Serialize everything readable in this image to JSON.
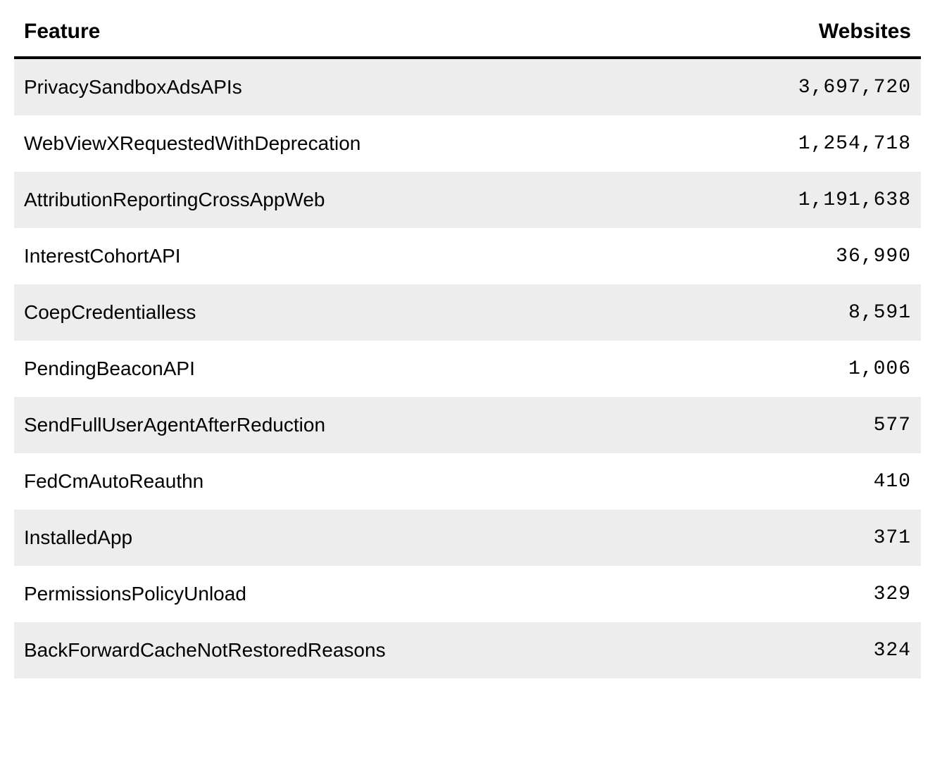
{
  "table": {
    "headers": {
      "feature": "Feature",
      "websites": "Websites"
    },
    "rows": [
      {
        "feature": "PrivacySandboxAdsAPIs",
        "websites": "3,697,720"
      },
      {
        "feature": "WebViewXRequestedWithDeprecation",
        "websites": "1,254,718"
      },
      {
        "feature": "AttributionReportingCrossAppWeb",
        "websites": "1,191,638"
      },
      {
        "feature": "InterestCohortAPI",
        "websites": "36,990"
      },
      {
        "feature": "CoepCredentialless",
        "websites": "8,591"
      },
      {
        "feature": "PendingBeaconAPI",
        "websites": "1,006"
      },
      {
        "feature": "SendFullUserAgentAfterReduction",
        "websites": "577"
      },
      {
        "feature": "FedCmAutoReauthn",
        "websites": "410"
      },
      {
        "feature": "InstalledApp",
        "websites": "371"
      },
      {
        "feature": "PermissionsPolicyUnload",
        "websites": "329"
      },
      {
        "feature": "BackForwardCacheNotRestoredReasons",
        "websites": "324"
      }
    ]
  }
}
